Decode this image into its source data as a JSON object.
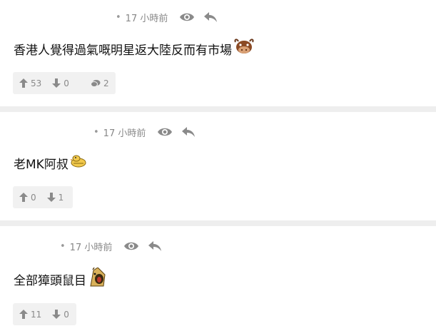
{
  "comments": [
    {
      "time": "17 小時前",
      "text": "香港人覺得過氣嘅明星返大陸反而有市場",
      "sticker": "ox-face-sticker",
      "upvotes": "53",
      "downvotes": "0",
      "replies": "2"
    },
    {
      "time": "17 小時前",
      "text": "老MK阿叔",
      "sticker": "duck-sticker",
      "upvotes": "0",
      "downvotes": "1"
    },
    {
      "time": "17 小時前",
      "text": "全部獐頭鼠目",
      "sticker": "shouting-rat-sticker",
      "upvotes": "11",
      "downvotes": "0"
    }
  ],
  "meta": {
    "bullet": "•"
  },
  "colors": {
    "divider": "#eeeeee",
    "button_bg": "#f1f1f1",
    "icon": "#8a8a8a",
    "meta_text": "#888888"
  },
  "icons": [
    "eye-icon",
    "reply-icon",
    "thumb-up-arrow-icon",
    "thumb-down-arrow-icon",
    "comment-bubble-icon"
  ]
}
